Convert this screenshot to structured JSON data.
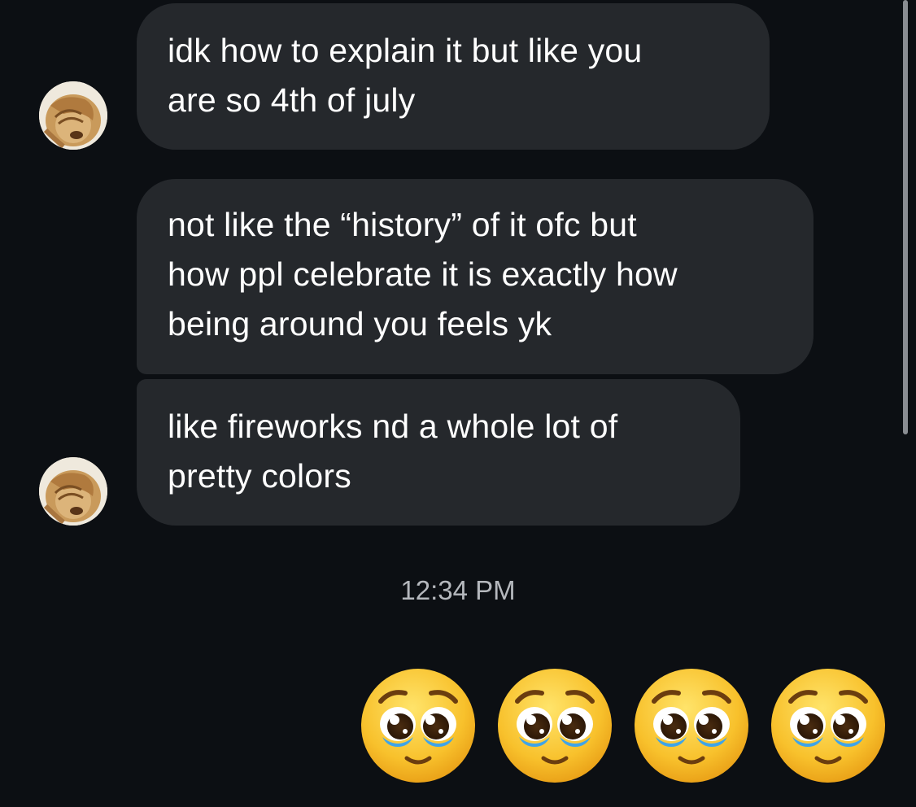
{
  "messages": [
    {
      "text": "idk how to explain it but like you\nare so 4th of july"
    },
    {
      "text": "not like the “history” of it ofc but\nhow ppl celebrate it is exactly how\nbeing around you feels yk"
    },
    {
      "text": "like fireworks nd a whole lot of\npretty colors"
    }
  ],
  "timestamp": "12:34 PM",
  "reaction": {
    "emoji_name": "pleading-face-emoji",
    "count": 4
  },
  "colors": {
    "background": "#0c0f13",
    "bubble": "#25282c",
    "text": "#ffffff",
    "timestamp": "#b5b8bd",
    "emoji_face": "#f6c02d"
  }
}
